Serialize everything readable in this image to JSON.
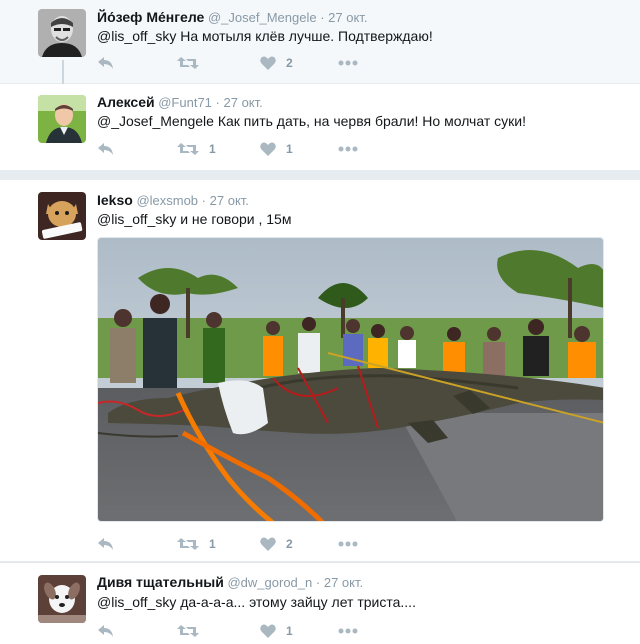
{
  "tweets": [
    {
      "name": "Йо́зеф Ме́нгеле",
      "handle": "@_Josef_Mengele",
      "sep": "·",
      "time": "27 окт.",
      "text": "@lis_off_sky На мотыля клёв лучше. Подтверждаю!",
      "retweets": "",
      "likes": "2"
    },
    {
      "name": "Алексей",
      "handle": "@Funt71",
      "sep": "·",
      "time": "27 окт.",
      "text": "@_Josef_Mengele Как пить дать, на червя брали! Но молчат суки!",
      "retweets": "1",
      "likes": "1"
    },
    {
      "name": "Iekso",
      "handle": "@lexsmob",
      "sep": "·",
      "time": "27 окт.",
      "text": "@lis_off_sky и не говори , 15м",
      "retweets": "1",
      "likes": "2"
    },
    {
      "name": "Дивя тщательный",
      "handle": "@dw_gorod_n",
      "sep": "·",
      "time": "27 окт.",
      "text": "@lis_off_sky да-а-а-а... этому зайцу лет триста....",
      "retweets": "",
      "likes": "1"
    }
  ],
  "colors": {
    "name": "#14171a",
    "muted": "#8899a6",
    "icon": "#aab8c2",
    "background": "#e6ecf0"
  }
}
